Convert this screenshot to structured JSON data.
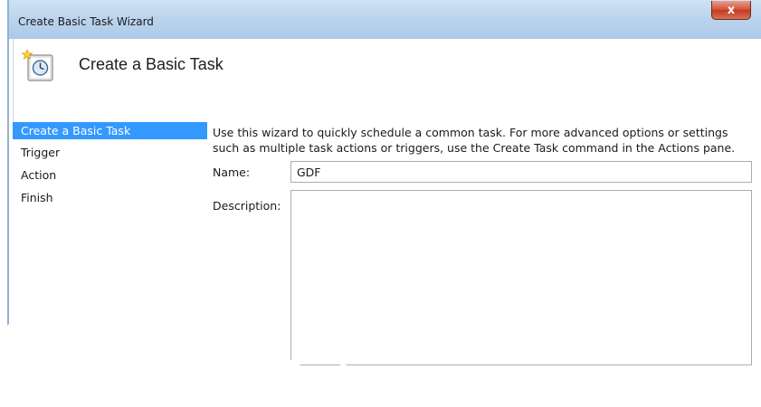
{
  "window": {
    "title": "Create Basic Task Wizard",
    "close_glyph": "x"
  },
  "header": {
    "title": "Create a Basic Task",
    "icon": "task-scheduler-clock-icon"
  },
  "sidebar": {
    "items": [
      {
        "label": "Create a Basic Task",
        "selected": true
      },
      {
        "label": "Trigger",
        "selected": false
      },
      {
        "label": "Action",
        "selected": false
      },
      {
        "label": "Finish",
        "selected": false
      }
    ]
  },
  "content": {
    "intro_line1": "Use this wizard to quickly schedule a common task.  For more advanced options or settings",
    "intro_line2": "such as multiple task actions or triggers, use the Create Task command in the Actions pane.",
    "name_label": "Name:",
    "name_value": "GDF",
    "description_label": "Description:",
    "description_value": ""
  },
  "colors": {
    "selection": "#3399ff",
    "close_button": "#c9452a",
    "titlebar": "#bcd5ee"
  }
}
